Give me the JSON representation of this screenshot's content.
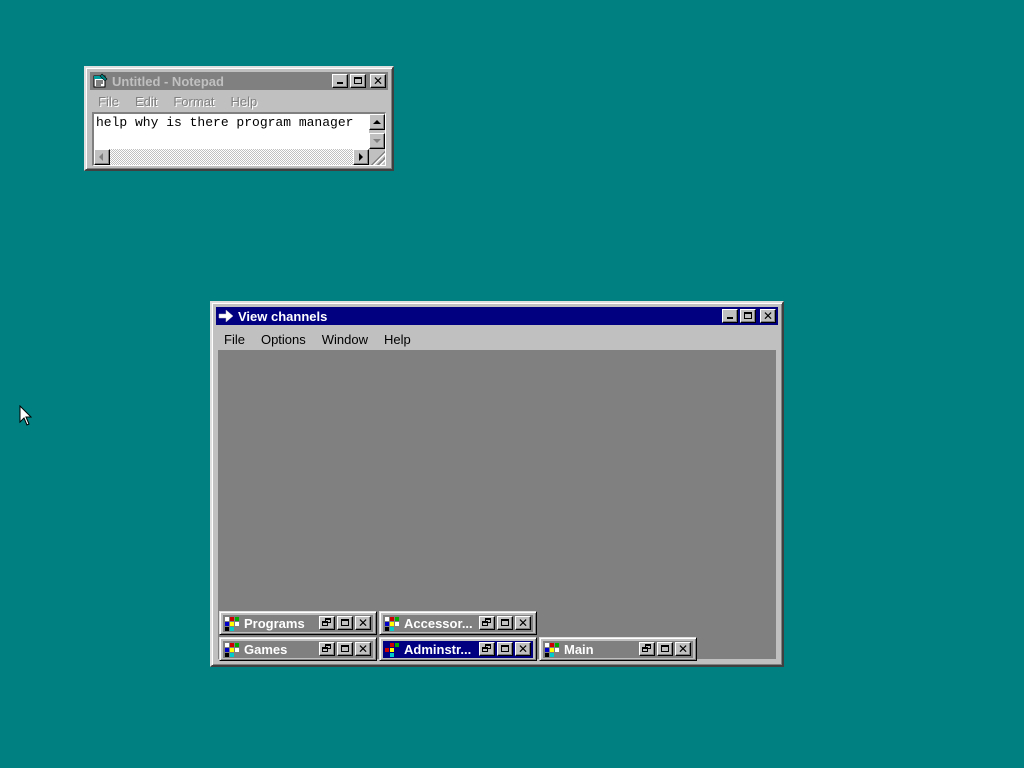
{
  "notepad": {
    "title": "Untitled - Notepad",
    "menu": [
      "File",
      "Edit",
      "Format",
      "Help"
    ],
    "content": "help why is there program manager"
  },
  "view_channels": {
    "title": "View channels",
    "menu": [
      "File",
      "Options",
      "Window",
      "Help"
    ],
    "groups": [
      {
        "label": "Programs",
        "active": false
      },
      {
        "label": "Accessor...",
        "active": false
      },
      {
        "label": "Games",
        "active": false
      },
      {
        "label": "Adminstr...",
        "active": true
      },
      {
        "label": "Main",
        "active": false
      }
    ]
  },
  "colors": {
    "desktop": "#008080",
    "active_title": "#000080",
    "inactive_title": "#808080",
    "face": "#c0c0c0"
  },
  "icons": [
    "notepad-icon",
    "arrow-icon",
    "program-group-icon",
    "mouse-cursor-icon"
  ]
}
